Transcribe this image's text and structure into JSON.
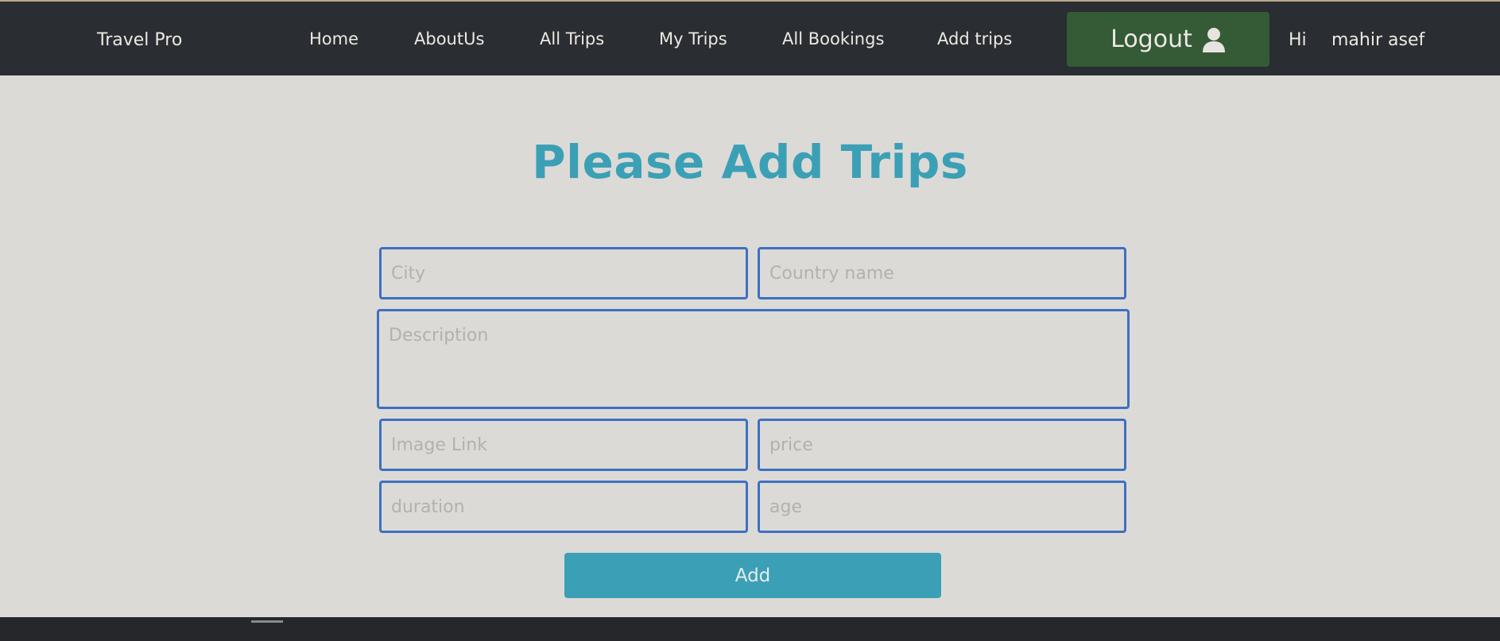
{
  "navbar": {
    "brand": "Travel Pro",
    "links": [
      "Home",
      "AboutUs",
      "All Trips",
      "My Trips",
      "All Bookings",
      "Add trips"
    ],
    "logout_label": "Logout",
    "logout_icon": "user-icon",
    "greeting": "Hi",
    "username": "mahir asef"
  },
  "form": {
    "title": "Please Add Trips",
    "city_placeholder": "City",
    "country_placeholder": "Country name",
    "description_placeholder": "Description",
    "image_placeholder": "Image Link",
    "price_placeholder": "price",
    "duration_placeholder": "duration",
    "age_placeholder": "age",
    "submit_label": "Add"
  },
  "colors": {
    "navbar_bg": "#2a2d31",
    "logout_bg": "#355a36",
    "accent": "#3ba0b5",
    "field_border": "#3d70c0",
    "page_bg": "#dcdad7"
  }
}
